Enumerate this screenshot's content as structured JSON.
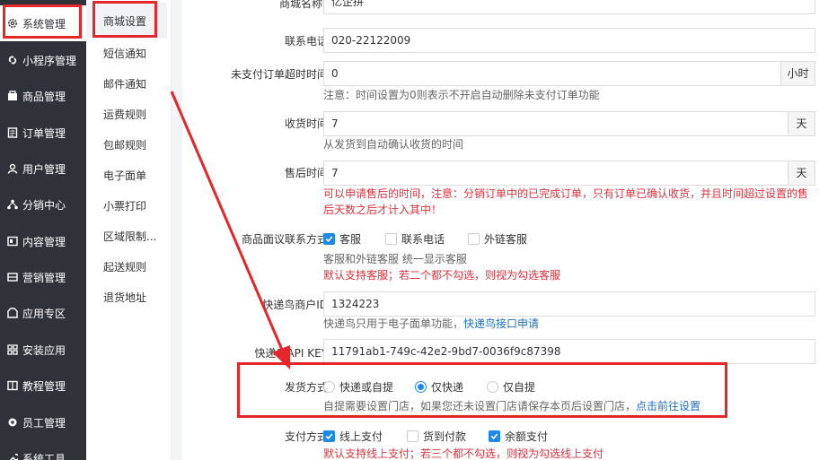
{
  "sidebar": {
    "items": [
      {
        "label": "系统管理",
        "icon": "gear-icon"
      },
      {
        "label": "小程序管理",
        "icon": "link-icon"
      },
      {
        "label": "商品管理",
        "icon": "box-icon"
      },
      {
        "label": "订单管理",
        "icon": "list-icon"
      },
      {
        "label": "用户管理",
        "icon": "user-icon"
      },
      {
        "label": "分销中心",
        "icon": "network-icon"
      },
      {
        "label": "内容管理",
        "icon": "content-icon"
      },
      {
        "label": "营销管理",
        "icon": "marketing-icon"
      },
      {
        "label": "应用专区",
        "icon": "app-icon"
      },
      {
        "label": "安装应用",
        "icon": "grid-icon"
      },
      {
        "label": "教程管理",
        "icon": "book-icon"
      },
      {
        "label": "员工管理",
        "icon": "gear-icon"
      },
      {
        "label": "系统工具",
        "icon": "tool-icon"
      }
    ]
  },
  "submenu": {
    "items": [
      "商城设置",
      "短信通知",
      "邮件通知",
      "运费规则",
      "包邮规则",
      "电子面单",
      "小票打印",
      "区域限制...",
      "起送规则",
      "退货地址"
    ]
  },
  "form": {
    "store_name": {
      "label": "商城名称",
      "required": "*",
      "value": "亿企拼"
    },
    "phone": {
      "label": "联系电话",
      "value": "020-22122009"
    },
    "unpaid_timeout": {
      "label": "未支付订单超时时间",
      "value": "0",
      "unit": "小时",
      "help": "注意：时间设置为0则表示不开启自动删除未支付订单功能"
    },
    "receive_time": {
      "label": "收货时间",
      "value": "7",
      "unit": "天",
      "help": "从发货到自动确认收货的时间"
    },
    "after_sale": {
      "label": "售后时间",
      "value": "7",
      "unit": "天",
      "help1": "可以申请售后的时间，",
      "help1_red": "注意：分销订单中的已完成订单，只有订单已确认收货，并且时间超过设置的售",
      "help2": "后天数之后才计入其中！"
    },
    "contact": {
      "label": "商品面议联系方式",
      "options": [
        {
          "label": "客服",
          "checked": true
        },
        {
          "label": "联系电话",
          "checked": false
        },
        {
          "label": "外链客服",
          "checked": false
        }
      ],
      "help": "客服和外链客服 统一显示客服",
      "help_red": "默认支持客服；若二个都不勾选，则视为勾选客服"
    },
    "kdn_id": {
      "label": "快递鸟商户ID",
      "value": "1324223",
      "help": "快递鸟只用于电子面单功能，",
      "help_link": "快递鸟接口申请"
    },
    "kdn_key": {
      "label": "快递鸟API KEY",
      "value": "11791ab1-749c-42e2-9bd7-0036f9c87398"
    },
    "delivery": {
      "label": "发货方式",
      "options": [
        {
          "label": "快递或自提",
          "checked": false
        },
        {
          "label": "仅快递",
          "checked": true
        },
        {
          "label": "仅自提",
          "checked": false
        }
      ],
      "help": "自提需要设置门店，如果您还未设置门店请保存本页后设置门店，",
      "help_link": "点击前往设置"
    },
    "payment": {
      "label": "支付方式",
      "options": [
        {
          "label": "线上支付",
          "checked": true
        },
        {
          "label": "货到付款",
          "checked": false
        },
        {
          "label": "余额支付",
          "checked": true
        }
      ],
      "help_red": "默认支持线上支付；若三个都不勾选，则视为勾选线上支付"
    }
  },
  "colors": {
    "sidebar_bg": "#2f3238",
    "accent": "#1e88e5",
    "annotation": "#e5262a",
    "warning_text": "#e2323c"
  }
}
